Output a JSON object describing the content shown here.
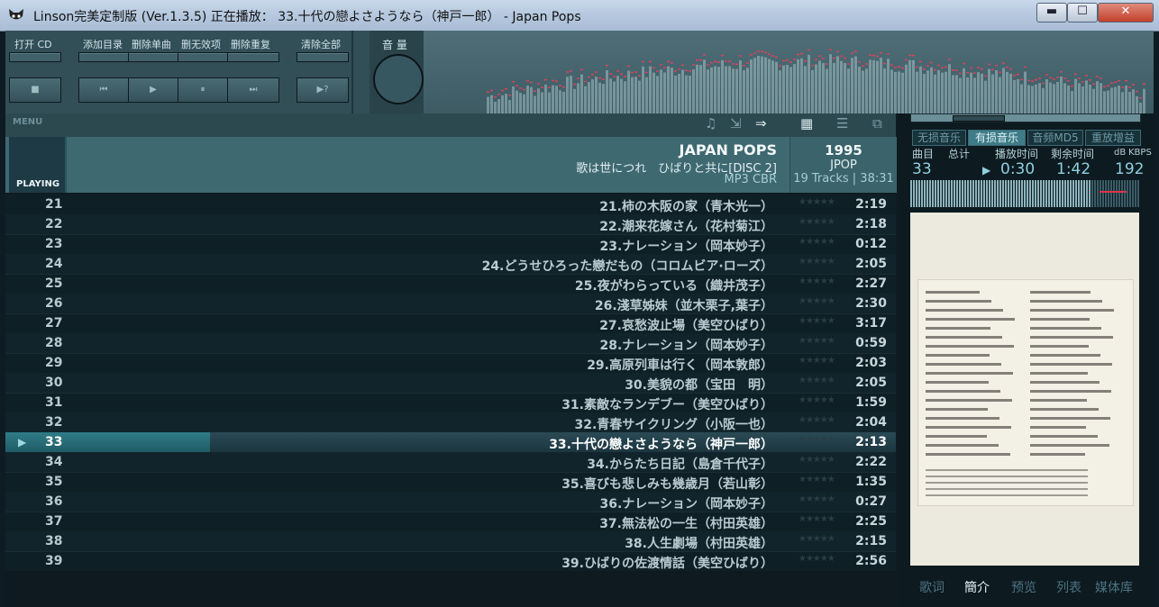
{
  "window": {
    "title": "Linson完美定制版 (Ver.1.3.5)    正在播放： 33.十代の戀よさようなら（神戸一郎） - Japan Pops",
    "controls": {
      "minimize": "▬",
      "maximize": "☐",
      "close": "✕"
    }
  },
  "toolbar": {
    "open_cd": "打开 CD",
    "add_dir": "添加目录",
    "del_single": "删除单曲",
    "del_invalid": "删无效项",
    "del_dup": "删除重复",
    "clear_all": "清除全部",
    "volume": "音 量",
    "btn_stop": "■",
    "btn_prev": "⏮",
    "btn_play": "▶",
    "btn_pause": "⏸",
    "btn_next": "⏭",
    "btn_random": "▶?"
  },
  "strip": {
    "menu": "MENU"
  },
  "header": {
    "playing": "PLAYING",
    "album": "JAPAN POPS",
    "subtitle": "歌は世につれ　ひばりと共に[DISC 2]",
    "codec": "MP3 CBR",
    "year": "1995",
    "genre": "JPOP",
    "tracks": "19 Tracks | 38:31"
  },
  "playlist": [
    {
      "num": "21",
      "title": "21.柿の木阪の家（青木光一）",
      "dur": "2:19"
    },
    {
      "num": "22",
      "title": "22.潮来花嫁さん（花村菊江）",
      "dur": "2:18"
    },
    {
      "num": "23",
      "title": "23.ナレーション（岡本妙子）",
      "dur": "0:12"
    },
    {
      "num": "24",
      "title": "24.どうせひろった戀だもの（コロムビア·ローズ）",
      "dur": "2:05"
    },
    {
      "num": "25",
      "title": "25.夜がわらっている（織井茂子）",
      "dur": "2:27"
    },
    {
      "num": "26",
      "title": "26.淺草姊妹（並木栗子,葉子）",
      "dur": "2:30"
    },
    {
      "num": "27",
      "title": "27.哀愁波止場（美空ひばり）",
      "dur": "3:17"
    },
    {
      "num": "28",
      "title": "28.ナレーション（岡本妙子）",
      "dur": "0:59"
    },
    {
      "num": "29",
      "title": "29.高原列車は行く（岡本敦郎）",
      "dur": "2:03"
    },
    {
      "num": "30",
      "title": "30.美貌の都（宝田　明）",
      "dur": "2:05"
    },
    {
      "num": "31",
      "title": "31.素敵なランデブー（美空ひばり）",
      "dur": "1:59"
    },
    {
      "num": "32",
      "title": "32.青春サイクリング（小阪一也）",
      "dur": "2:04"
    },
    {
      "num": "33",
      "title": "33.十代の戀よさようなら（神戸一郎）",
      "dur": "2:13",
      "current": true,
      "progress": 0.23
    },
    {
      "num": "34",
      "title": "34.からたち日記（島倉千代子）",
      "dur": "2:22"
    },
    {
      "num": "35",
      "title": "35.喜びも悲しみも幾歳月（若山彰）",
      "dur": "1:35"
    },
    {
      "num": "36",
      "title": "36.ナレーション（岡本妙子）",
      "dur": "0:27"
    },
    {
      "num": "37",
      "title": "37.無法松の一生（村田英雄）",
      "dur": "2:25"
    },
    {
      "num": "38",
      "title": "38.人生劇場（村田英雄）",
      "dur": "2:15"
    },
    {
      "num": "39",
      "title": "39.ひばりの佐渡情話（美空ひばり）",
      "dur": "2:56"
    }
  ],
  "right": {
    "tabs": [
      "无损音乐",
      "有损音乐",
      "音频MD5",
      "重放增益"
    ],
    "col_track": "曲目",
    "col_total": "总计",
    "col_played": "播放时间",
    "col_remain": "剩余时间",
    "col_db": "dB",
    "col_kbps": "KBPS",
    "val_track": "33",
    "val_play_icon": "▶",
    "val_played": "0:30",
    "val_remain": "1:42",
    "val_kbps": "192",
    "bottom_tabs": [
      "歌词",
      "簡介",
      "预览",
      "列表",
      "媒体库"
    ]
  },
  "colors": {
    "accent": "#3f6971",
    "current_row": "#2f7c86",
    "bg": "#0f1f26"
  }
}
